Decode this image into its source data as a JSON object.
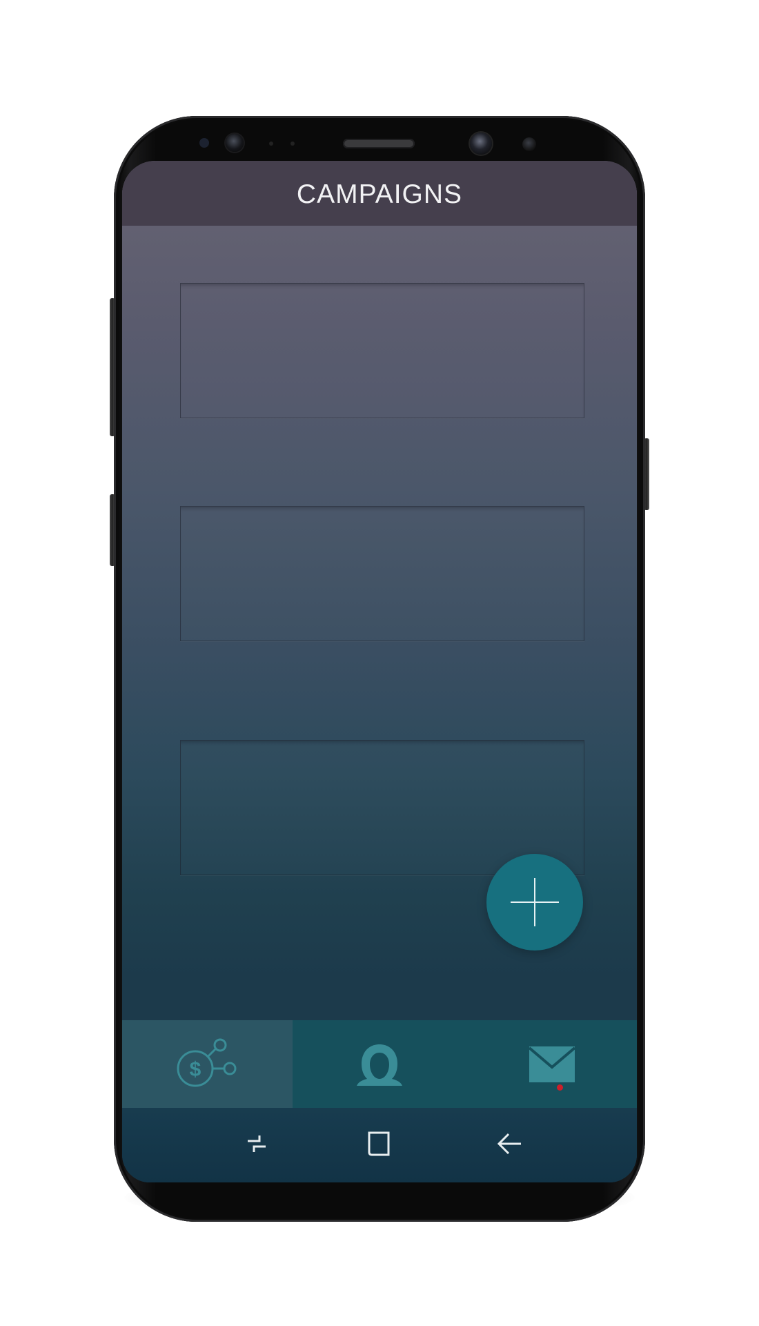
{
  "app": {
    "title": "CAMPAIGNS"
  },
  "campaign_cards": [
    {
      "id": "card-1"
    },
    {
      "id": "card-2"
    },
    {
      "id": "card-3"
    }
  ],
  "fab": {
    "icon": "plus-icon"
  },
  "bottom_nav": {
    "active_tab": "campaigns",
    "tabs": [
      {
        "id": "campaigns",
        "icon": "dollar-network-icon"
      },
      {
        "id": "profile",
        "icon": "user-icon"
      },
      {
        "id": "messages",
        "icon": "envelope-icon",
        "has_notification": true
      }
    ]
  },
  "system_nav": {
    "buttons": [
      {
        "id": "recent-apps",
        "icon": "recent-apps-icon"
      },
      {
        "id": "home",
        "icon": "home-icon"
      },
      {
        "id": "back",
        "icon": "back-arrow-icon"
      }
    ]
  },
  "colors": {
    "header_bg": "#453f4d",
    "fab_bg": "#17707f",
    "bottom_nav_bg": "#16505c",
    "active_tab_bg": "#2c5664",
    "icon_teal": "#3a8d97",
    "notification_dot": "#cc1f2a"
  }
}
